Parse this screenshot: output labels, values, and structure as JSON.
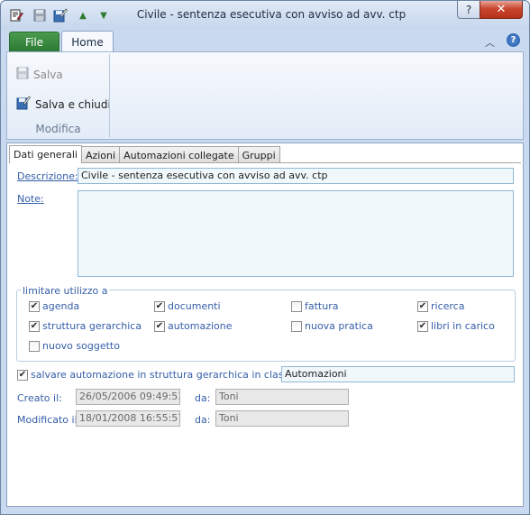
{
  "window": {
    "title": "Civile - sentenza esecutiva con avviso ad avv. ctp",
    "help_label": "?",
    "close_label": "✕"
  },
  "ribbon": {
    "file_tab": "File",
    "home_tab": "Home",
    "save_label": "Salva",
    "save_close_label": "Salva e chiudi",
    "group_label": "Modifica"
  },
  "tabs": [
    "Dati generali",
    "Azioni",
    "Automazioni collegate",
    "Gruppi"
  ],
  "form": {
    "descrizione_label": "Descrizione:",
    "descrizione_value": "Civile - sentenza esecutiva con avviso ad avv. ctp",
    "note_label": "Note:",
    "note_value": "",
    "limit_legend": "limitare utilizzo a",
    "checks": [
      {
        "label": "agenda",
        "checked": true
      },
      {
        "label": "documenti",
        "checked": true
      },
      {
        "label": "fattura",
        "checked": false
      },
      {
        "label": "ricerca",
        "checked": true
      },
      {
        "label": "struttura gerarchica",
        "checked": true
      },
      {
        "label": "automazione",
        "checked": true
      },
      {
        "label": "nuova pratica",
        "checked": false
      },
      {
        "label": "libri in carico",
        "checked": true
      },
      {
        "label": "nuovo soggetto",
        "checked": false
      }
    ],
    "save_in_class_label": "salvare automazione in struttura gerarchica in classe:",
    "save_in_class_checked": true,
    "class_value": "Automazioni",
    "created_label": "Creato il:",
    "created_value": "26/05/2006 09:49:53",
    "created_by_label": "da:",
    "created_by_value": "Toni",
    "modified_label": "Modificato il:",
    "modified_value": "18/01/2008 16:55:57",
    "modified_by_label": "da:",
    "modified_by_value": "Toni"
  }
}
